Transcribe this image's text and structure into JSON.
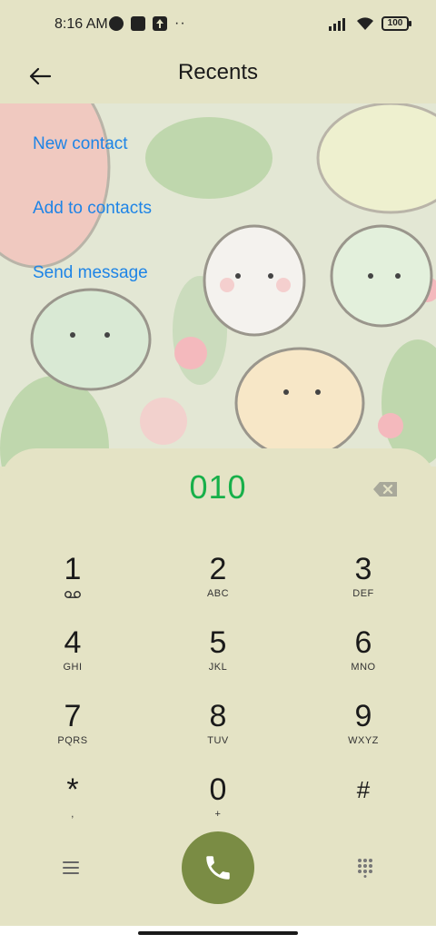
{
  "status_bar": {
    "time": "8:16 AM",
    "battery": "100",
    "icons_left": [
      "data-saver-icon",
      "square-app-icon",
      "upload-icon",
      "more-dots-icon"
    ],
    "icons_right": [
      "signal-icon",
      "wifi-icon",
      "battery-icon"
    ]
  },
  "header": {
    "title": "Recents",
    "back_icon": "arrow-left-icon"
  },
  "actions": {
    "new_contact": "New contact",
    "add_to_contacts": "Add to contacts",
    "send_message": "Send message"
  },
  "dialer": {
    "number": "010",
    "backspace_icon": "backspace-icon",
    "keys": [
      {
        "digit": "1",
        "letters": ""
      },
      {
        "digit": "2",
        "letters": "ABC"
      },
      {
        "digit": "3",
        "letters": "DEF"
      },
      {
        "digit": "4",
        "letters": "GHI"
      },
      {
        "digit": "5",
        "letters": "JKL"
      },
      {
        "digit": "6",
        "letters": "MNO"
      },
      {
        "digit": "7",
        "letters": "PQRS"
      },
      {
        "digit": "8",
        "letters": "TUV"
      },
      {
        "digit": "9",
        "letters": "WXYZ"
      },
      {
        "digit": "*",
        "letters": ","
      },
      {
        "digit": "0",
        "letters": "+"
      },
      {
        "digit": "#",
        "letters": ""
      }
    ]
  },
  "colors": {
    "background": "#e4e3c5",
    "link": "#1e84e6",
    "number": "#18b04a",
    "call_button": "#7a8c44"
  }
}
